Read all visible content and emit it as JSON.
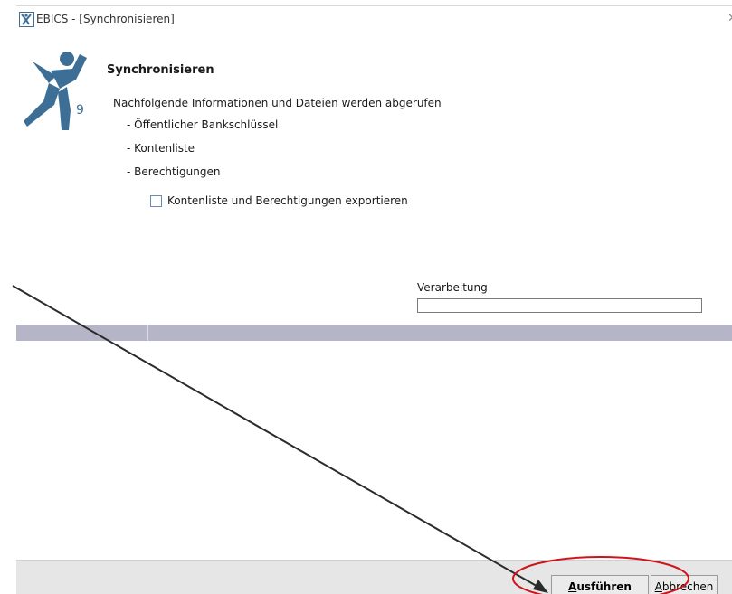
{
  "window": {
    "title": "EBICS - [Synchronisieren]",
    "close_glyph": "✕"
  },
  "logo": {
    "icon": "ebics-person-logo-icon",
    "number": "9",
    "color": "#3d6f96"
  },
  "content": {
    "heading": "Synchronisieren",
    "intro": "Nachfolgende Informationen und Dateien werden abgerufen",
    "items": [
      "- Öffentlicher Bankschlüssel",
      "- Kontenliste",
      "- Berechtigungen"
    ],
    "export_checkbox": {
      "label": "Kontenliste und Berechtigungen exportieren",
      "checked": false
    }
  },
  "processing": {
    "label": "Verarbeitung",
    "progress": 0
  },
  "buttons": {
    "run_first": "A",
    "run_rest": "usführen",
    "cancel_first": "A",
    "cancel_rest": "bbrechen"
  },
  "annotation": {
    "arrow_color": "#2b2b2b",
    "highlight_color": "#d0121b",
    "highlight_target": "run-button"
  }
}
